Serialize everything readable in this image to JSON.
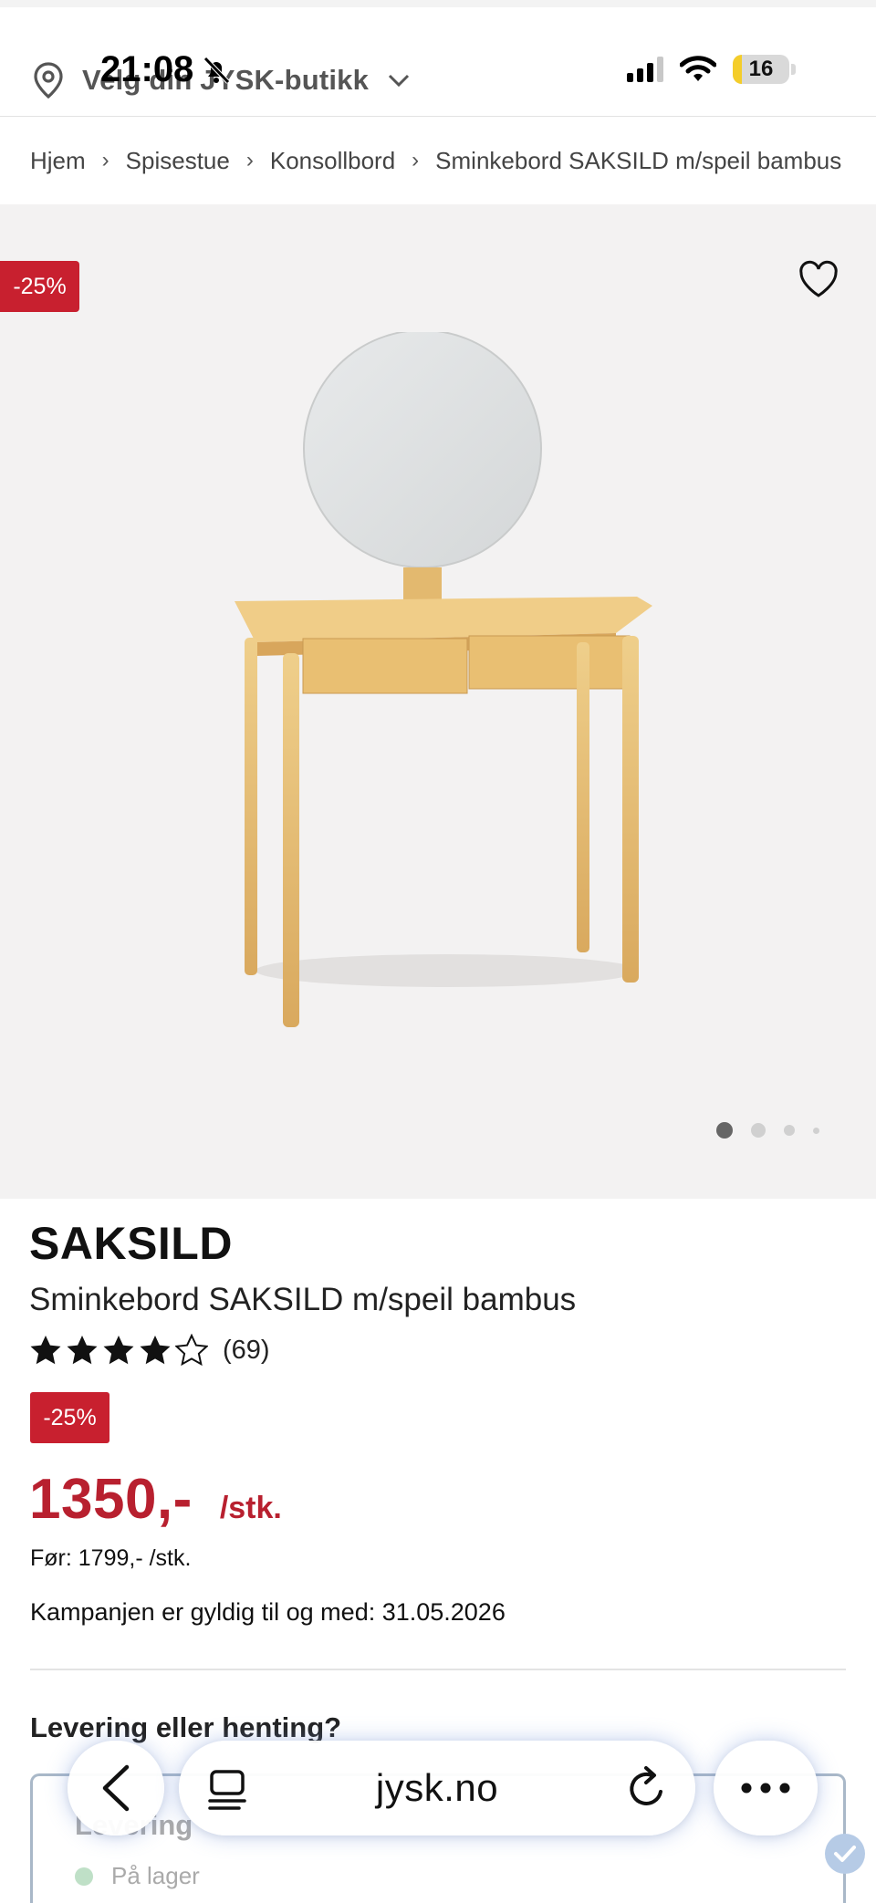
{
  "status_bar": {
    "time": "21:08",
    "battery": "16",
    "battery_level": 0.16
  },
  "store_picker": {
    "label": "Velg din JYSK-butikk"
  },
  "breadcrumb": {
    "items": [
      "Hjem",
      "Spisestue",
      "Konsollbord",
      "Sminkebord SAKSILD m/speil bambus"
    ]
  },
  "gallery": {
    "discount": "-25%",
    "slide_count": 4,
    "active_slide": 1
  },
  "product": {
    "brand": "SAKSILD",
    "name": "Sminkebord SAKSILD m/speil bambus",
    "rating": 4,
    "rating_max": 5,
    "review_count": "(69)",
    "discount_badge": "-25%",
    "price": "1350,-",
    "unit": "/stk.",
    "before_price": "Før: 1799,- /stk.",
    "campaign": "Kampanjen er gyldig til og med: 31.05.2026"
  },
  "delivery": {
    "heading": "Levering eller henting?",
    "option_title": "Levering",
    "stock_status": "På lager"
  },
  "browser": {
    "url": "jysk.no"
  },
  "colors": {
    "accent_red": "#c8202f",
    "price_red": "#b8202f",
    "gallery_bg": "#f3f2f2"
  },
  "icons": [
    "location-pin-icon",
    "chevron-down-icon",
    "bell-slash-icon",
    "signal-icon",
    "wifi-icon",
    "battery-icon",
    "chevron-right-icon",
    "heart-icon",
    "star-icon",
    "back-icon",
    "tabs-icon",
    "reload-icon",
    "more-icon",
    "check-icon"
  ]
}
